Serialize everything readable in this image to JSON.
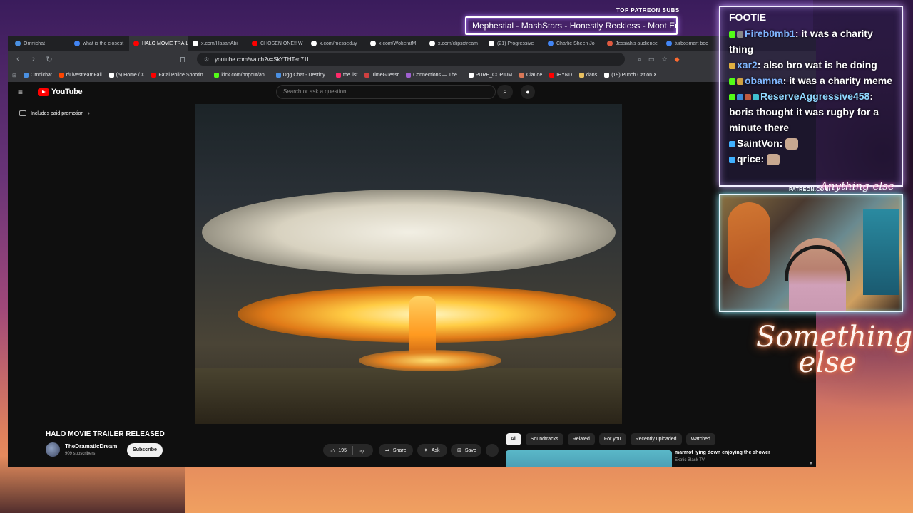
{
  "overlay": {
    "patreon_label": "TOP PATREON SUBS",
    "ticker_text": "Mephestial - MashStars - Honestly Reckless - Moot Enjoyer",
    "patreon_tag": "PATREON.COM/",
    "neon_small": "Anything else",
    "neon_sign": "Something else"
  },
  "browser": {
    "tabs": [
      {
        "label": "Omnichat",
        "icon_color": "#4a90e2"
      },
      {
        "label": "what is the closest",
        "icon_color": "#4285f4"
      },
      {
        "label": "HALO MOVIE TRAILER",
        "icon_color": "#ff0000",
        "active": true
      },
      {
        "label": "x.com/HasanAbi",
        "icon_color": "#ffffff"
      },
      {
        "label": "CHOSEN ONE!! W",
        "icon_color": "#ff0000"
      },
      {
        "label": "x.com/messeduy",
        "icon_color": "#ffffff"
      },
      {
        "label": "x.com/WokeratM",
        "icon_color": "#ffffff"
      },
      {
        "label": "x.com/clipsxtream",
        "icon_color": "#ffffff"
      },
      {
        "label": "(21) Progressive",
        "icon_color": "#ffffff"
      },
      {
        "label": "Charlie Sheen Jo",
        "icon_color": "#4285f4"
      },
      {
        "label": "Jessiah's audience",
        "icon_color": "#e05a40"
      },
      {
        "label": "turbosmart boo",
        "icon_color": "#4285f4"
      }
    ],
    "url": "youtube.com/watch?v=SkYTHTen71I",
    "bookmarks": [
      {
        "label": "Omnichat",
        "color": "#4a90e2"
      },
      {
        "label": "r/LivestreamFail",
        "color": "#ff4500"
      },
      {
        "label": "(5) Home / X",
        "color": "#ffffff"
      },
      {
        "label": "Fatal Police Shootin...",
        "color": "#ff0000"
      },
      {
        "label": "kick.com/popout/an...",
        "color": "#53fc18"
      },
      {
        "label": "Dgg Chat - Destiny...",
        "color": "#4a90e2"
      },
      {
        "label": "the list",
        "color": "#ff2a6a"
      },
      {
        "label": "TimeGuessr",
        "color": "#d04040"
      },
      {
        "label": "Connections — The...",
        "color": "#a060d0"
      },
      {
        "label": "PURE_COPIUM",
        "color": "#ffffff"
      },
      {
        "label": "Claude",
        "color": "#d97757"
      },
      {
        "label": "IHYND",
        "color": "#ff0000"
      },
      {
        "label": "dans",
        "color": "#e8c060"
      },
      {
        "label": "(19) Punch Cat on X...",
        "color": "#ffffff"
      }
    ]
  },
  "youtube": {
    "search_placeholder": "Search or ask a question",
    "promo": "Includes paid promotion",
    "video_title": "HALO MOVIE TRAILER RELEASED",
    "channel_name": "TheDramaticDream",
    "channel_subs": "909 subscribers",
    "subscribe": "Subscribe",
    "likes": "195",
    "share": "Share",
    "ask": "Ask",
    "save": "Save",
    "filters": [
      "All",
      "Soundtracks",
      "Related",
      "For you",
      "Recently uploaded",
      "Watched"
    ],
    "rec_title": "marmot lying down enjoying the shower",
    "rec_channel": "Exotic Black TV"
  },
  "chat": {
    "title": "FOOTIE",
    "messages": [
      {
        "user": "Fireb0mb1",
        "text": " it was a charity thing",
        "user_class": "user-blue",
        "badge_colors": [
          "#53fc18",
          "#888888"
        ]
      },
      {
        "user": "xar2",
        "text": " also bro wat is he doing",
        "user_class": "user-blue",
        "badge_colors": [
          "#e0b040"
        ]
      },
      {
        "user": "obamna",
        "text": " it was a charity meme",
        "user_class": "user-blue",
        "badge_colors": [
          "#53fc18",
          "#d0a040"
        ]
      },
      {
        "user": "ReserveAggressive458",
        "text": " boris thought it was rugby for a minute there",
        "user_class": "user-teal",
        "badge_colors": [
          "#53fc18",
          "#3a8ad8",
          "#c05a40",
          "#40c0d0"
        ]
      },
      {
        "user": "SaintVon",
        "text": "",
        "user_class": "user-plain",
        "badge_colors": [
          "#40b0ff"
        ]
      },
      {
        "user": "qrice",
        "text": "",
        "user_class": "user-plain",
        "badge_colors": [
          "#40b0ff"
        ]
      }
    ]
  }
}
